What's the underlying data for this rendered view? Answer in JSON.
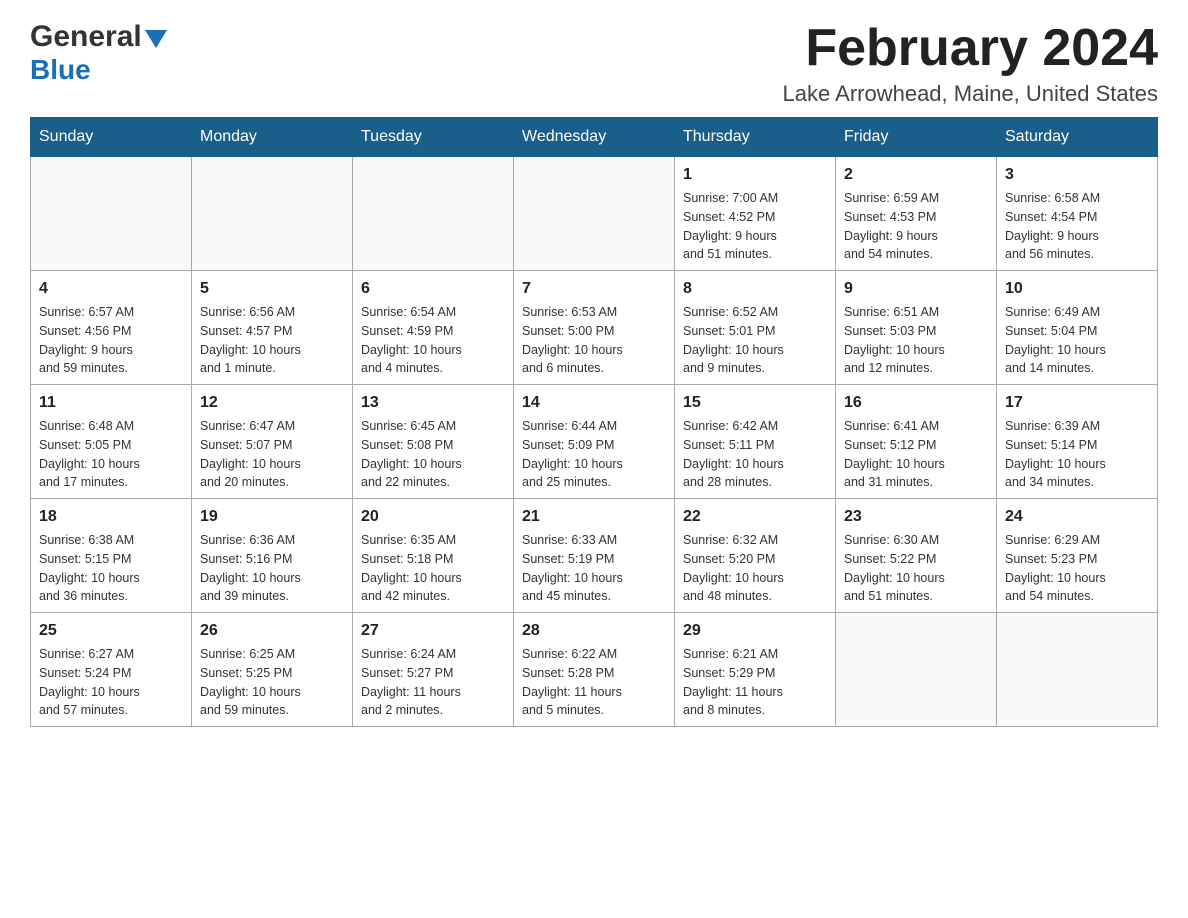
{
  "header": {
    "logo_general": "General",
    "logo_blue": "Blue",
    "month_title": "February 2024",
    "location": "Lake Arrowhead, Maine, United States"
  },
  "days_of_week": [
    "Sunday",
    "Monday",
    "Tuesday",
    "Wednesday",
    "Thursday",
    "Friday",
    "Saturday"
  ],
  "weeks": [
    [
      {
        "day": "",
        "info": ""
      },
      {
        "day": "",
        "info": ""
      },
      {
        "day": "",
        "info": ""
      },
      {
        "day": "",
        "info": ""
      },
      {
        "day": "1",
        "info": "Sunrise: 7:00 AM\nSunset: 4:52 PM\nDaylight: 9 hours\nand 51 minutes."
      },
      {
        "day": "2",
        "info": "Sunrise: 6:59 AM\nSunset: 4:53 PM\nDaylight: 9 hours\nand 54 minutes."
      },
      {
        "day": "3",
        "info": "Sunrise: 6:58 AM\nSunset: 4:54 PM\nDaylight: 9 hours\nand 56 minutes."
      }
    ],
    [
      {
        "day": "4",
        "info": "Sunrise: 6:57 AM\nSunset: 4:56 PM\nDaylight: 9 hours\nand 59 minutes."
      },
      {
        "day": "5",
        "info": "Sunrise: 6:56 AM\nSunset: 4:57 PM\nDaylight: 10 hours\nand 1 minute."
      },
      {
        "day": "6",
        "info": "Sunrise: 6:54 AM\nSunset: 4:59 PM\nDaylight: 10 hours\nand 4 minutes."
      },
      {
        "day": "7",
        "info": "Sunrise: 6:53 AM\nSunset: 5:00 PM\nDaylight: 10 hours\nand 6 minutes."
      },
      {
        "day": "8",
        "info": "Sunrise: 6:52 AM\nSunset: 5:01 PM\nDaylight: 10 hours\nand 9 minutes."
      },
      {
        "day": "9",
        "info": "Sunrise: 6:51 AM\nSunset: 5:03 PM\nDaylight: 10 hours\nand 12 minutes."
      },
      {
        "day": "10",
        "info": "Sunrise: 6:49 AM\nSunset: 5:04 PM\nDaylight: 10 hours\nand 14 minutes."
      }
    ],
    [
      {
        "day": "11",
        "info": "Sunrise: 6:48 AM\nSunset: 5:05 PM\nDaylight: 10 hours\nand 17 minutes."
      },
      {
        "day": "12",
        "info": "Sunrise: 6:47 AM\nSunset: 5:07 PM\nDaylight: 10 hours\nand 20 minutes."
      },
      {
        "day": "13",
        "info": "Sunrise: 6:45 AM\nSunset: 5:08 PM\nDaylight: 10 hours\nand 22 minutes."
      },
      {
        "day": "14",
        "info": "Sunrise: 6:44 AM\nSunset: 5:09 PM\nDaylight: 10 hours\nand 25 minutes."
      },
      {
        "day": "15",
        "info": "Sunrise: 6:42 AM\nSunset: 5:11 PM\nDaylight: 10 hours\nand 28 minutes."
      },
      {
        "day": "16",
        "info": "Sunrise: 6:41 AM\nSunset: 5:12 PM\nDaylight: 10 hours\nand 31 minutes."
      },
      {
        "day": "17",
        "info": "Sunrise: 6:39 AM\nSunset: 5:14 PM\nDaylight: 10 hours\nand 34 minutes."
      }
    ],
    [
      {
        "day": "18",
        "info": "Sunrise: 6:38 AM\nSunset: 5:15 PM\nDaylight: 10 hours\nand 36 minutes."
      },
      {
        "day": "19",
        "info": "Sunrise: 6:36 AM\nSunset: 5:16 PM\nDaylight: 10 hours\nand 39 minutes."
      },
      {
        "day": "20",
        "info": "Sunrise: 6:35 AM\nSunset: 5:18 PM\nDaylight: 10 hours\nand 42 minutes."
      },
      {
        "day": "21",
        "info": "Sunrise: 6:33 AM\nSunset: 5:19 PM\nDaylight: 10 hours\nand 45 minutes."
      },
      {
        "day": "22",
        "info": "Sunrise: 6:32 AM\nSunset: 5:20 PM\nDaylight: 10 hours\nand 48 minutes."
      },
      {
        "day": "23",
        "info": "Sunrise: 6:30 AM\nSunset: 5:22 PM\nDaylight: 10 hours\nand 51 minutes."
      },
      {
        "day": "24",
        "info": "Sunrise: 6:29 AM\nSunset: 5:23 PM\nDaylight: 10 hours\nand 54 minutes."
      }
    ],
    [
      {
        "day": "25",
        "info": "Sunrise: 6:27 AM\nSunset: 5:24 PM\nDaylight: 10 hours\nand 57 minutes."
      },
      {
        "day": "26",
        "info": "Sunrise: 6:25 AM\nSunset: 5:25 PM\nDaylight: 10 hours\nand 59 minutes."
      },
      {
        "day": "27",
        "info": "Sunrise: 6:24 AM\nSunset: 5:27 PM\nDaylight: 11 hours\nand 2 minutes."
      },
      {
        "day": "28",
        "info": "Sunrise: 6:22 AM\nSunset: 5:28 PM\nDaylight: 11 hours\nand 5 minutes."
      },
      {
        "day": "29",
        "info": "Sunrise: 6:21 AM\nSunset: 5:29 PM\nDaylight: 11 hours\nand 8 minutes."
      },
      {
        "day": "",
        "info": ""
      },
      {
        "day": "",
        "info": ""
      }
    ]
  ]
}
